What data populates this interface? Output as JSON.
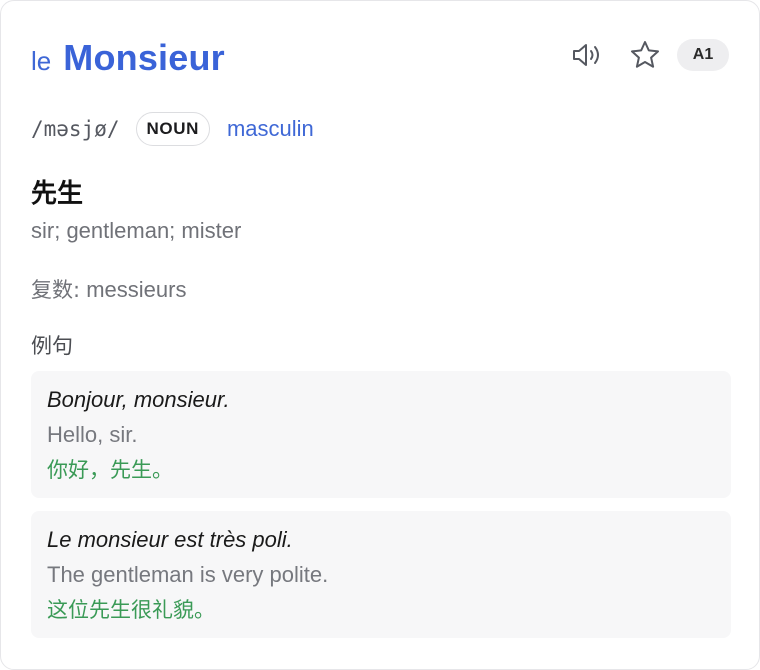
{
  "entry": {
    "article": "le",
    "word": "Monsieur",
    "level": "A1",
    "ipa": "/məsjø/",
    "pos": "NOUN",
    "gender": "masculin",
    "translation": "先生",
    "gloss": "sir; gentleman; mister",
    "plural_label": "复数:",
    "plural_value": "messieurs"
  },
  "actions": {
    "speaker_icon": "speaker-icon",
    "star_icon": "star-icon"
  },
  "examples_title": "例句",
  "examples": [
    {
      "fr": "Bonjour, monsieur.",
      "en": "Hello, sir.",
      "zh": "你好，先生。"
    },
    {
      "fr": "Le monsieur est très poli.",
      "en": "The gentleman is very polite.",
      "zh": "这位先生很礼貌。"
    }
  ],
  "colors": {
    "accent_blue": "#3a63d8",
    "example_green": "#3a9a56",
    "muted_gray": "#707278",
    "badge_bg": "#eeeef0"
  }
}
